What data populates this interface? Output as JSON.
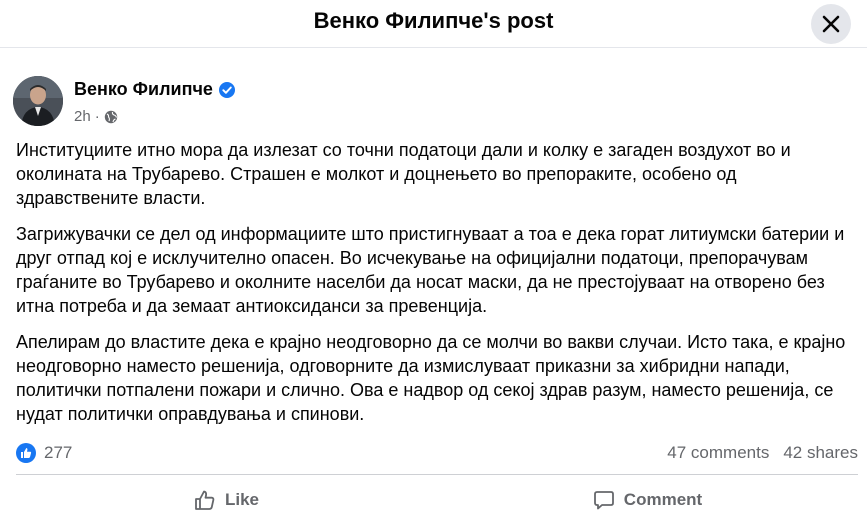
{
  "header": {
    "title": "Венко Филипче's post"
  },
  "author": {
    "name": "Венко Филипче",
    "verified": true
  },
  "meta": {
    "time": "2h",
    "audience_icon": "globe-icon"
  },
  "post": {
    "paragraphs": [
      "Институциите итно мора да излезат со точни податоци дали и колку е загаден воздухот во и околината на Трубарево. Страшен е молкот и доцнењето во препораките, особено од здравствените власти.",
      "Загрижувачки се дел од информациите што пристигнуваат а тоа е дека горат литиумски батерии и друг отпад кој е исклучително опасен. Во исчекување на официјални податоци, препорачувам граѓаните во Трубарево и околните населби да носат маски, да не престојуваат на отворено без итна потреба и да земаат антиоксиданси за превенција.",
      "Апелирам до властите дека е крајно неодговорно да се молчи во вакви случаи. Исто така, е крајно неодговорно наместо решенија, одговорните да измислуваат приказни за хибридни напади, политички потпалени пожари и слично. Ова е надвор од секој здрав разум, наместо решенија, се нудат политички оправдувања и спинови."
    ]
  },
  "stats": {
    "reactions": "277",
    "comments": "47 comments",
    "shares": "42 shares"
  },
  "actions": {
    "like": "Like",
    "comment": "Comment"
  },
  "colors": {
    "accent": "#1877f2",
    "secondary_text": "#65676b",
    "close_bg": "#e4e6eb"
  }
}
